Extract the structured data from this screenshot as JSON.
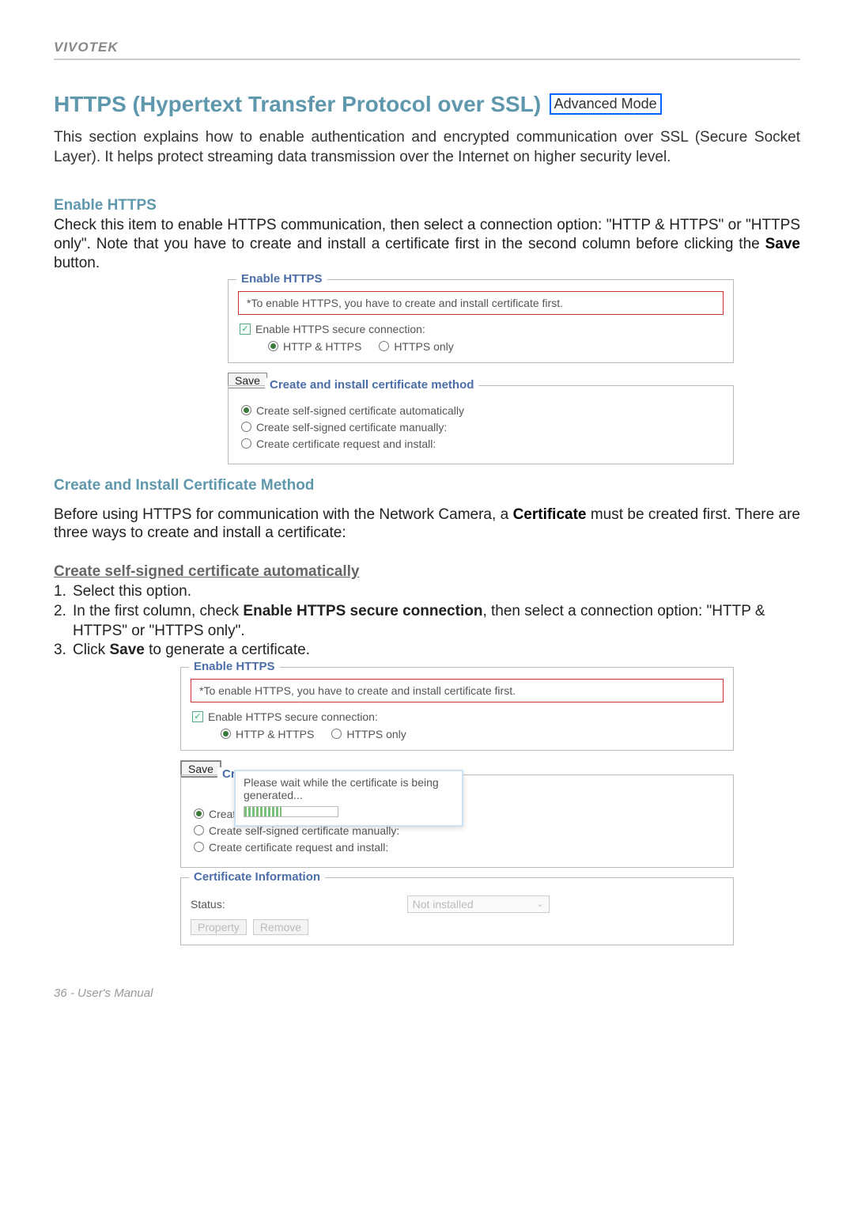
{
  "brand": "VIVOTEK",
  "page_title": "HTTPS (Hypertext Transfer Protocol over SSL)",
  "mode_badge": "Advanced Mode",
  "intro": "This section explains how to enable authentication and encrypted communication over SSL (Secure Socket Layer). It helps protect streaming data transmission over the Internet on higher security level.",
  "sec1": {
    "heading": "Enable HTTPS",
    "body_pre": "Check this item to enable HTTPS communication, then select a connection option: \"HTTP & HTTPS\" or \"HTTPS only\". Note that you have to create and install a certificate first in the second column before clicking the ",
    "body_bold": "Save",
    "body_post": " button."
  },
  "shot1": {
    "legend_enable": "Enable HTTPS",
    "note": "*To enable HTTPS, you have to create and install certificate first.",
    "checkbox_label": "Enable HTTPS secure connection:",
    "radio_a": "HTTP & HTTPS",
    "radio_b": "HTTPS only",
    "save": "Save",
    "legend_method": "Create and install certificate method",
    "opt1": "Create self-signed certificate automatically",
    "opt2": "Create self-signed certificate manually:",
    "opt3": "Create certificate request and install:"
  },
  "sec2": {
    "heading": "Create and Install Certificate Method",
    "body_pre": "Before using HTTPS for communication with the Network Camera, a ",
    "body_bold": "Certificate",
    "body_post": " must be created first. There are three ways to create and install a certificate:"
  },
  "sub": {
    "title": "Create self-signed certificate automatically",
    "steps": [
      "Select this option.",
      "In the first column, check Enable HTTPS secure connection, then select a connection option: \"HTTP & HTTPS\" or \"HTTPS only\".",
      "Click Save to generate a certificate."
    ],
    "step2_pre": "In the first column, check ",
    "step2_bold": "Enable HTTPS secure connection",
    "step2_post": ", then select a connection option: \"HTTP & HTTPS\" or \"HTTPS only\".",
    "step3_pre": "Click ",
    "step3_bold": "Save",
    "step3_post": " to generate a certificate."
  },
  "shot2": {
    "legend_enable": "Enable HTTPS",
    "note": "*To enable HTTPS, you have to create and install certificate first.",
    "checkbox_label": "Enable HTTPS secure connection:",
    "radio_a": "HTTP & HTTPS",
    "radio_b": "HTTPS only",
    "save": "Save",
    "legend_method_partial": "Cre",
    "popup_text": "Please wait while the certificate is being generated...",
    "opt1": "Create self-signed certificate automatically",
    "opt2": "Create self-signed certificate manually:",
    "opt3": "Create certificate request and install:",
    "legend_cert_info": "Certificate Information",
    "status_label": "Status:",
    "status_value": "Not installed",
    "btn_property": "Property",
    "btn_remove": "Remove"
  },
  "footer": "36 - User's Manual"
}
